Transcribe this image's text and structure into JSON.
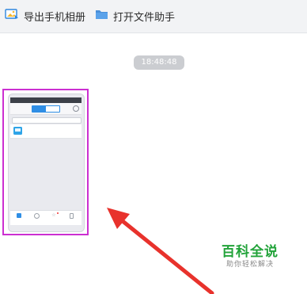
{
  "toolbar": {
    "export_label": "导出手机相册",
    "open_label": "打开文件助手",
    "export_icon": "photo-export-icon",
    "open_icon": "folder-icon"
  },
  "chat": {
    "timestamp": "18:48:48"
  },
  "colors": {
    "highlight_border": "#cc2fd1",
    "arrow": "#e8322c",
    "watermark_green": "#22a33a",
    "timestamp_bg": "#cbcdd1"
  },
  "watermark": {
    "title": "百科全说",
    "subtitle": "助你轻松解决"
  }
}
